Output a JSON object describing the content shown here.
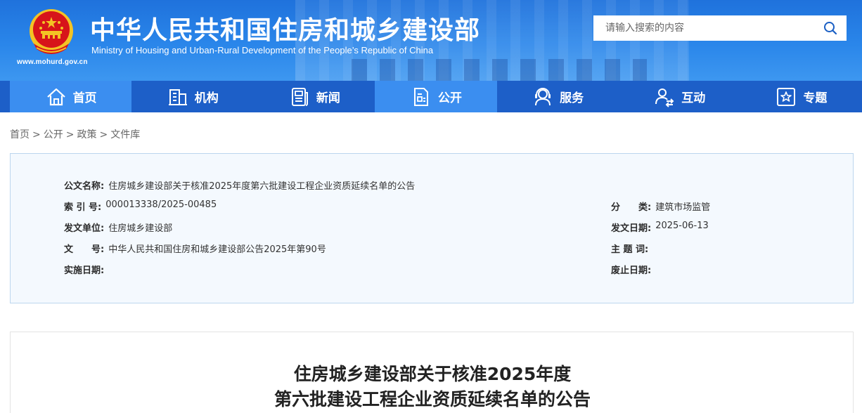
{
  "header": {
    "site_title": "中华人民共和国住房和城乡建设部",
    "site_subtitle": "Ministry of Housing and Urban-Rural Development of the People’s Republic of China",
    "site_url": "www.mohurd.gov.cn",
    "emblem_icon": "national-emblem-icon",
    "search": {
      "placeholder": "请输入搜索的内容",
      "value": "",
      "icon": "search-icon"
    },
    "colors": {
      "header_blue": "#2a86ea",
      "nav_blue": "#1d5fc8",
      "nav_active": "#3b8ef0",
      "emblem_red": "#d7141a",
      "emblem_gold": "#f3c324"
    }
  },
  "nav": {
    "items": [
      {
        "label": "首页",
        "icon": "home-icon",
        "active": true
      },
      {
        "label": "机构",
        "icon": "building-icon",
        "active": false
      },
      {
        "label": "新闻",
        "icon": "newspaper-icon",
        "active": false
      },
      {
        "label": "公开",
        "icon": "document-icon",
        "active": true
      },
      {
        "label": "服务",
        "icon": "service-icon",
        "active": false
      },
      {
        "label": "互动",
        "icon": "interaction-icon",
        "active": false
      },
      {
        "label": "专题",
        "icon": "star-icon",
        "active": false
      }
    ]
  },
  "breadcrumb": {
    "items": [
      "首页",
      "公开",
      "政策",
      "文件库"
    ],
    "separator": ">"
  },
  "info": {
    "doc_name_label": "公文名称:",
    "doc_name_value": "住房城乡建设部关于核准2025年度第六批建设工程企业资质延续名单的公告",
    "index_label": "索 引 号:",
    "index_value": "000013338/2025-00485",
    "category_label": "分　　类:",
    "category_value": "建筑市场监管",
    "issuer_label": "发文单位:",
    "issuer_value": "住房城乡建设部",
    "date_label": "发文日期:",
    "date_value": "2025-06-13",
    "doc_no_label": "文　　号:",
    "doc_no_value": "中华人民共和国住房和城乡建设部公告2025年第90号",
    "keywords_label": "主 题 词:",
    "keywords_value": "",
    "effective_label": "实施日期:",
    "effective_value": "",
    "expire_label": "废止日期:",
    "expire_value": ""
  },
  "article": {
    "title_line1": "住房城乡建设部关于核准2025年度",
    "title_line2": "第六批建设工程企业资质延续名单的公告"
  }
}
